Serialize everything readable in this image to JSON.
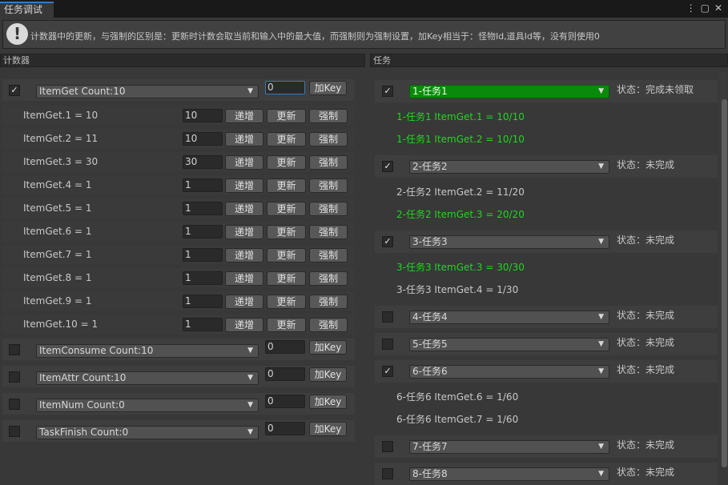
{
  "window": {
    "tab_title": "任务调试"
  },
  "help": {
    "text": "计数器中的更新，与强制的区别是：更新时计数会取当前和输入中的最大值，而强制则为强制设置，加Key相当于：怪物Id,道具Id等，没有则使用0"
  },
  "counter_header": "计数器",
  "task_header": "任务",
  "buttons": {
    "add_key": "加Key",
    "increment": "递增",
    "update": "更新",
    "force": "强制"
  },
  "counters": [
    {
      "name": "ItemGet  Count:10",
      "checked": true,
      "input": "0",
      "entries": [
        {
          "label": "ItemGet.1 = 10",
          "value": "10"
        },
        {
          "label": "ItemGet.2 = 11",
          "value": "10"
        },
        {
          "label": "ItemGet.3 = 30",
          "value": "30"
        },
        {
          "label": "ItemGet.4 = 1",
          "value": "1"
        },
        {
          "label": "ItemGet.5 = 1",
          "value": "1"
        },
        {
          "label": "ItemGet.6 = 1",
          "value": "1"
        },
        {
          "label": "ItemGet.7 = 1",
          "value": "1"
        },
        {
          "label": "ItemGet.8 = 1",
          "value": "1"
        },
        {
          "label": "ItemGet.9 = 1",
          "value": "1"
        },
        {
          "label": "ItemGet.10 = 1",
          "value": "1"
        }
      ]
    },
    {
      "name": "ItemConsume  Count:10",
      "checked": false,
      "input": "0",
      "entries": []
    },
    {
      "name": "ItemAttr  Count:10",
      "checked": false,
      "input": "0",
      "entries": []
    },
    {
      "name": "ItemNum  Count:0",
      "checked": false,
      "input": "0",
      "entries": []
    },
    {
      "name": "TaskFinish  Count:0",
      "checked": false,
      "input": "0",
      "entries": []
    }
  ],
  "tasks": [
    {
      "name": "1-任务1",
      "checked": true,
      "highlight": true,
      "status": "状态：完成未领取",
      "details": [
        {
          "text": "1-任务1    ItemGet.1 = 10/10",
          "done": true
        },
        {
          "text": "1-任务1    ItemGet.2 = 10/10",
          "done": true
        }
      ]
    },
    {
      "name": "2-任务2",
      "checked": true,
      "highlight": false,
      "status": "状态：未完成",
      "details": [
        {
          "text": "2-任务2    ItemGet.2 = 11/20",
          "done": false
        },
        {
          "text": "2-任务2    ItemGet.3 = 20/20",
          "done": true
        }
      ]
    },
    {
      "name": "3-任务3",
      "checked": true,
      "highlight": false,
      "status": "状态：未完成",
      "details": [
        {
          "text": "3-任务3    ItemGet.3 = 30/30",
          "done": true
        },
        {
          "text": "3-任务3    ItemGet.4 = 1/30",
          "done": false
        }
      ]
    },
    {
      "name": "4-任务4",
      "checked": false,
      "highlight": false,
      "status": "状态：未完成",
      "details": []
    },
    {
      "name": "5-任务5",
      "checked": false,
      "highlight": false,
      "status": "状态：未完成",
      "details": []
    },
    {
      "name": "6-任务6",
      "checked": true,
      "highlight": false,
      "status": "状态：未完成",
      "details": [
        {
          "text": "6-任务6    ItemGet.6 = 1/60",
          "done": false
        },
        {
          "text": "6-任务6    ItemGet.7 = 1/60",
          "done": false
        }
      ]
    },
    {
      "name": "7-任务7",
      "checked": false,
      "highlight": false,
      "status": "状态：未完成",
      "details": []
    },
    {
      "name": "8-任务8",
      "checked": false,
      "highlight": false,
      "status": "状态：未完成",
      "details": []
    }
  ],
  "colors": {
    "accent": "#3a79bb",
    "done_text": "#1ed81e",
    "highlight_dropdown": "#0a8a0a"
  },
  "icons": {
    "help": "exclamation-icon",
    "checkbox": "checkmark-icon",
    "dropdown": "triangle-down-icon"
  }
}
